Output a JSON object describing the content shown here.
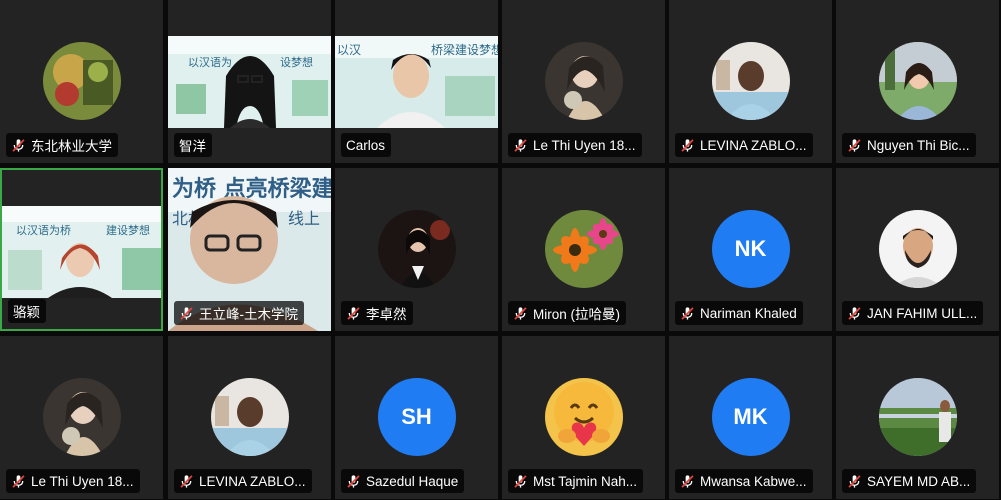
{
  "participants": [
    {
      "name": "东北林业大学",
      "muted": true,
      "display": "photo",
      "avatar_icon": "animation-still-avatar"
    },
    {
      "name": "智洋",
      "muted": false,
      "display": "video",
      "avatar_icon": "camera-feed-woman-glasses"
    },
    {
      "name": "Carlos",
      "muted": false,
      "display": "video",
      "avatar_icon": "camera-feed-young-man"
    },
    {
      "name": "Le Thi Uyen 18...",
      "muted": true,
      "display": "photo",
      "avatar_icon": "illustrated-girl-avatar"
    },
    {
      "name": "LEVINA ZABLO...",
      "muted": true,
      "display": "photo",
      "avatar_icon": "man-portrait-avatar"
    },
    {
      "name": "Nguyen Thi Bic...",
      "muted": true,
      "display": "photo",
      "avatar_icon": "woman-outdoor-avatar"
    },
    {
      "name": "骆颖",
      "muted": false,
      "display": "video",
      "active_speaker": true,
      "avatar_icon": "camera-feed-woman-red-hair"
    },
    {
      "name": "王立峰-土木学院",
      "muted": true,
      "display": "video",
      "avatar_icon": "camera-feed-man-glasses"
    },
    {
      "name": "李卓然",
      "muted": true,
      "display": "photo",
      "avatar_icon": "woman-dark-background-avatar"
    },
    {
      "name": "Miron (拉哈曼)",
      "muted": true,
      "display": "photo",
      "avatar_icon": "gerbera-flowers-avatar"
    },
    {
      "name": "Nariman Khaled",
      "muted": true,
      "display": "initials",
      "initials": "NK"
    },
    {
      "name": "JAN FAHIM ULL...",
      "muted": true,
      "display": "photo",
      "avatar_icon": "man-beard-avatar"
    },
    {
      "name": "Le Thi Uyen 18...",
      "muted": true,
      "display": "photo",
      "avatar_icon": "illustrated-girl-avatar"
    },
    {
      "name": "LEVINA ZABLO...",
      "muted": true,
      "display": "photo",
      "avatar_icon": "man-portrait-avatar"
    },
    {
      "name": "Sazedul Haque",
      "muted": true,
      "display": "initials",
      "initials": "SH"
    },
    {
      "name": "Mst Tajmin Nah...",
      "muted": true,
      "display": "photo",
      "avatar_icon": "hug-emoji-avatar"
    },
    {
      "name": "Mwansa Kabwe...",
      "muted": true,
      "display": "initials",
      "initials": "MK"
    },
    {
      "name": "SAYEM MD AB...",
      "muted": true,
      "display": "photo",
      "avatar_icon": "man-field-avatar"
    }
  ],
  "colors": {
    "tile_bg": "#232323",
    "initials_bg": "#1f7cf2",
    "active_border": "#3aa845",
    "muted_icon": "#e8453c"
  }
}
